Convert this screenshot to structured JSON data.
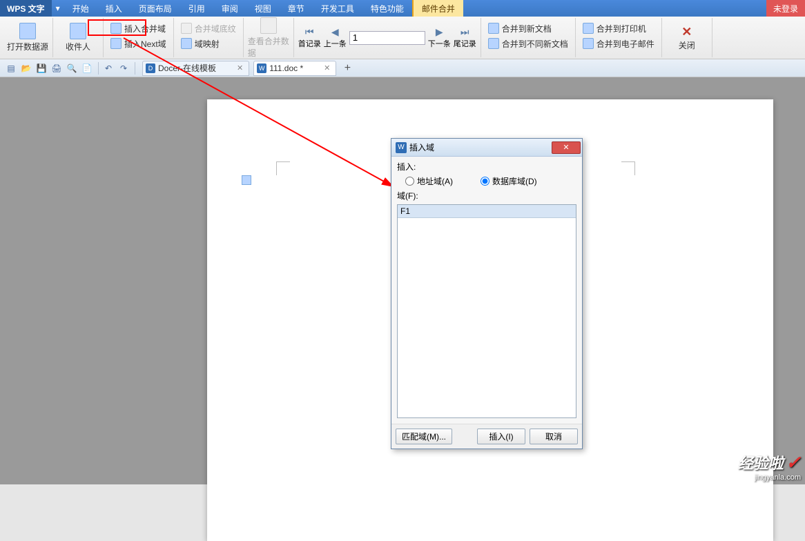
{
  "app_name": "WPS 文字",
  "login_status": "未登录",
  "menu": [
    "开始",
    "插入",
    "页面布局",
    "引用",
    "审阅",
    "视图",
    "章节",
    "开发工具",
    "特色功能",
    "邮件合并"
  ],
  "menu_active_index": 9,
  "ribbon": {
    "open_datasource": "打开数据源",
    "recipients": "收件人",
    "insert_merge_field": "插入合并域",
    "insert_next_field": "插入Next域",
    "merge_field_shading": "合并域底纹",
    "domain_mapping": "域映射",
    "view_merge_data": "查看合并数据",
    "first_record": "首记录",
    "prev_record": "上一条",
    "record_number": "1",
    "next_record": "下一条",
    "last_record": "尾记录",
    "merge_to_new_doc": "合并到新文档",
    "merge_to_diff_doc": "合并到不同新文档",
    "merge_to_printer": "合并到打印机",
    "merge_to_email": "合并到电子邮件",
    "close": "关闭"
  },
  "tabs": [
    {
      "icon": "D",
      "label": "Docer-在线模板",
      "active": false
    },
    {
      "icon": "W",
      "label": "111.doc *",
      "active": true
    }
  ],
  "dialog": {
    "title": "插入域",
    "insert_label": "插入:",
    "radio_address": "地址域(A)",
    "radio_database": "数据库域(D)",
    "radio_selected": "database",
    "field_label": "域(F):",
    "field_item": "F1",
    "btn_match": "匹配域(M)...",
    "btn_insert": "插入(I)",
    "btn_cancel": "取消"
  },
  "watermark": {
    "line1": "经验啦",
    "line2": "jingyanla.com"
  }
}
